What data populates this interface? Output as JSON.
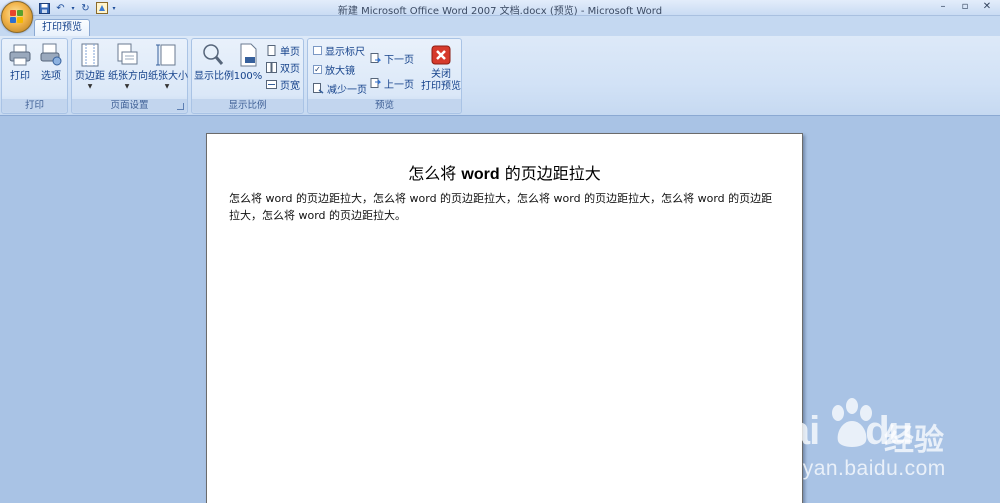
{
  "window": {
    "title": "新建 Microsoft Office Word 2007 文档.docx (预览) - Microsoft Word",
    "controls": [
      "–",
      "▫",
      "✕"
    ]
  },
  "tabs": [
    {
      "label": "打印预览",
      "active": true
    }
  ],
  "ribbon": {
    "print_group": {
      "label": "打印",
      "print": "打印",
      "options": "选项"
    },
    "page_setup_group": {
      "label": "页面设置",
      "margins": "页边距",
      "orientation": "纸张方向",
      "size": "纸张大小"
    },
    "zoom_group": {
      "label": "显示比例",
      "zoom": "显示比例",
      "hundred": "100%",
      "one_page": "单页",
      "two_pages": "双页",
      "page_width": "页宽"
    },
    "preview_group": {
      "label": "预览",
      "show_ruler": "显示标尺",
      "show_ruler_checked": false,
      "magnifier": "放大镜",
      "magnifier_checked": true,
      "shrink_one_page": "减少一页",
      "next_page": "下一页",
      "prev_page": "上一页",
      "close_line1": "关闭",
      "close_line2": "打印预览"
    }
  },
  "document": {
    "title_pre": "怎么将 ",
    "title_bold": "word",
    "title_post": " 的页边距拉大",
    "body": "怎么将 word 的页边距拉大，怎么将 word 的页边距拉大，怎么将 word 的页边距拉大，怎么将 word 的页边距拉大，怎么将 word 的页边距拉大。"
  },
  "watermark": {
    "brand": "Bai",
    "brand_suffix": "du",
    "jingyan": "经验",
    "url": "jingyan.baidu.com"
  },
  "colors": {
    "ribbon_bg": "#d2e2f6",
    "workspace_bg": "#a9c3e5",
    "close_red": "#d63a2c"
  }
}
